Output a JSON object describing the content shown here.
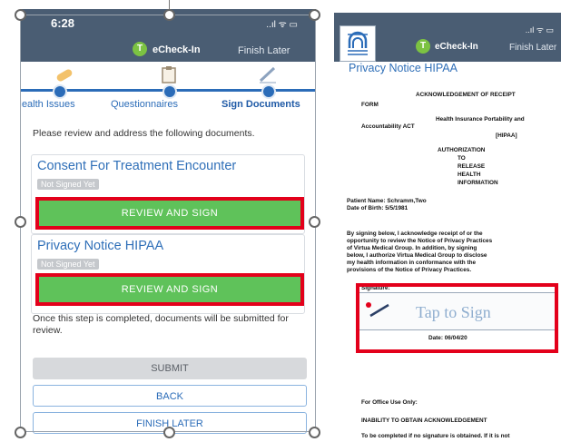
{
  "left": {
    "status": {
      "time": "6:28",
      "signal": "..ıl ᯤ ▭"
    },
    "header": {
      "check_letter": "T",
      "echeck_label": "eCheck-In",
      "finish_later": "Finish Later"
    },
    "steps": [
      {
        "label": "Health Issues",
        "icon": "bandage-icon"
      },
      {
        "label": "Questionnaires",
        "icon": "clipboard-icon"
      },
      {
        "label": "Sign Documents",
        "icon": "pen-icon"
      }
    ],
    "review_text": "Please review and address the following documents.",
    "documents": [
      {
        "title": "Consent For Treatment Encounter",
        "status": "Not Signed Yet",
        "button": "REVIEW AND SIGN"
      },
      {
        "title": "Privacy Notice HIPAA",
        "status": "Not Signed Yet",
        "button": "REVIEW AND SIGN"
      }
    ],
    "completed_text": "Once this step is completed, documents will be submitted for review.",
    "buttons": {
      "submit": "SUBMIT",
      "back": "BACK",
      "finish_later": "FINISH LATER"
    }
  },
  "right": {
    "status": {
      "signal": "..ıl ᯤ ▭"
    },
    "header": {
      "check_letter": "T",
      "echeck_label": "eCheck-In",
      "finish_later": "Finish Later"
    },
    "doc_title": "Privacy Notice HIPAA",
    "doc_lines": {
      "ack": "ACKNOWLEDGEMENT OF RECEIPT",
      "form": "FORM",
      "hipaa1": "Health Insurance Portability and",
      "hipaa2": "Accountability ACT",
      "hipaa3": "[HIPAA]",
      "auth1": "AUTHORIZATION",
      "auth2": "TO",
      "auth3": "RELEASE",
      "auth4": "HEALTH",
      "auth5": "INFORMATION",
      "patient": "Patient Name: Schramm,Two",
      "dob": "Date of Birth: 5/5/1981",
      "p1": "By signing below, I acknowledge receipt of or the",
      "p2": "opportunity to review the Notice of Privacy Practices",
      "p3": "of Virtua Medical Group.  In addition, by signing",
      "p4": "below, I authorize Virtua Medical Group to disclose",
      "p5": "my health information in conformance with the",
      "p6": "provisions of the Notice of Privacy Practices.",
      "sig_label": "Signature:",
      "tap_to_sign": "Tap to Sign",
      "date": "Date: 06/04/20",
      "office": "For Office Use Only:",
      "inability": "INABILITY TO OBTAIN ACKNOWLEDGEMENT",
      "complete": "To be completed if no signature is obtained.  If it is not"
    }
  },
  "colors": {
    "header": "#4a5d73",
    "accent": "#2b6cb8",
    "green": "#5fc25a",
    "highlight_red": "#e3001b"
  }
}
